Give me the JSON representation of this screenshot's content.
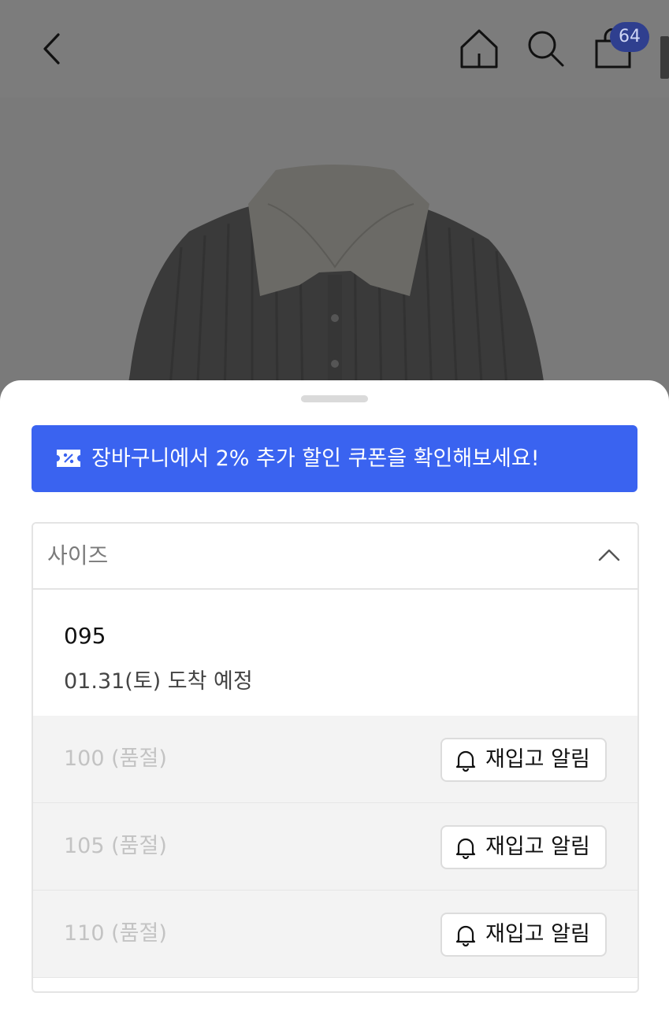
{
  "header": {
    "cart_count": "64"
  },
  "icons": {
    "back": "chevron-left-icon",
    "home": "home-icon",
    "search": "search-icon",
    "cart": "shopping-bag-icon",
    "coupon": "coupon-ticket-icon",
    "collapse": "chevron-up-icon",
    "bell": "bell-icon"
  },
  "coupon_banner": {
    "text": "장바구니에서 2% 추가 할인 쿠폰을 확인해보세요!",
    "color": "#3a63f0"
  },
  "size_selector": {
    "label": "사이즈",
    "options": [
      {
        "size": "095",
        "eta": "01.31(토) 도착 예정"
      },
      {
        "size": "100 (품절)",
        "button": "재입고 알림"
      },
      {
        "size": "105 (품절)",
        "button": "재입고 알림"
      },
      {
        "size": "110 (품절)",
        "button": "재입고 알림"
      }
    ]
  }
}
